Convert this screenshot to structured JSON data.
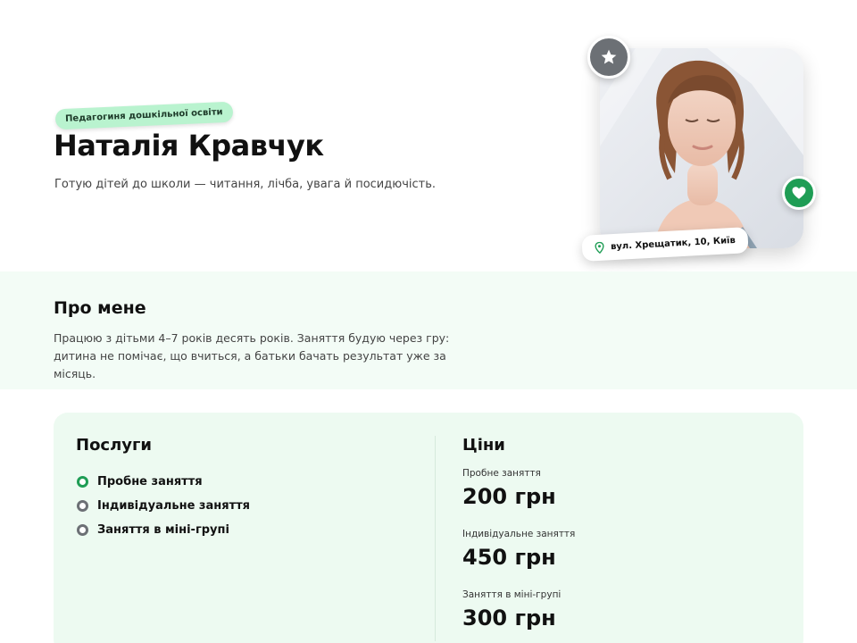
{
  "profile": {
    "tag": "Педагогиня дошкільної освіти",
    "name": "Наталія Кравчук",
    "tagline": "Готую дітей до школи — читання, лічба, увага й посидючість.",
    "location": "вул. Хрещатик, 10, Київ",
    "icons": {
      "star": "star-icon",
      "heart": "heart-icon",
      "pin": "map-pin-icon"
    }
  },
  "about": {
    "title": "Про мене",
    "text": "Працюю з дітьми 4–7 років десять років. Заняття будую через гру: дитина не помічає, що вчиться, а батьки бачать результат уже за місяць."
  },
  "services": {
    "title": "Послуги",
    "items": [
      {
        "label": "Пробне заняття",
        "active": true
      },
      {
        "label": "Індивідуальне заняття",
        "active": false
      },
      {
        "label": "Заняття в міні-групі",
        "active": false
      }
    ]
  },
  "prices": {
    "title": "Ціни",
    "items": [
      {
        "label": "Пробне заняття",
        "value": "200 грн"
      },
      {
        "label": "Індивідуальне заняття",
        "value": "450 грн"
      },
      {
        "label": "Заняття в міні-групі",
        "value": "300 грн"
      }
    ]
  },
  "colors": {
    "accent_green": "#1f9d55",
    "tag_bg": "#b9f3cf",
    "section_bg": "#f3fcf6",
    "card_bg": "#edfaf1",
    "badge_gray": "#6c7075"
  }
}
